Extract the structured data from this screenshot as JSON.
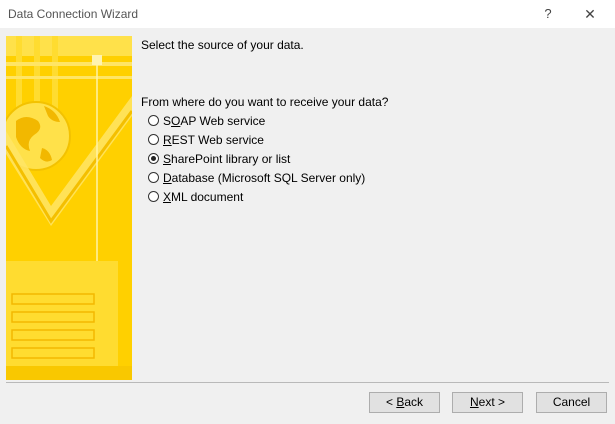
{
  "window": {
    "title": "Data Connection Wizard",
    "help_glyph": "?",
    "close_glyph": "✕"
  },
  "main": {
    "heading": "Select the source of your data.",
    "question": "From where do you want to receive your data?",
    "options": [
      {
        "pre": "S",
        "key": "O",
        "post": "AP Web service",
        "checked": false
      },
      {
        "pre": "",
        "key": "R",
        "post": "EST Web service",
        "checked": false
      },
      {
        "pre": "",
        "key": "S",
        "post": "harePoint library or list",
        "checked": true
      },
      {
        "pre": "",
        "key": "D",
        "post": "atabase (Microsoft SQL Server only)",
        "checked": false
      },
      {
        "pre": "",
        "key": "X",
        "post": "ML document",
        "checked": false
      }
    ]
  },
  "buttons": {
    "back": {
      "pre": "< ",
      "key": "B",
      "post": "ack"
    },
    "next": {
      "pre": "",
      "key": "N",
      "post": "ext >"
    },
    "cancel": {
      "pre": "Cancel",
      "key": "",
      "post": ""
    }
  },
  "colors": {
    "sidebar_yellow": "#ffd400",
    "sidebar_light": "#ffe566",
    "sidebar_orange": "#f6b800"
  }
}
